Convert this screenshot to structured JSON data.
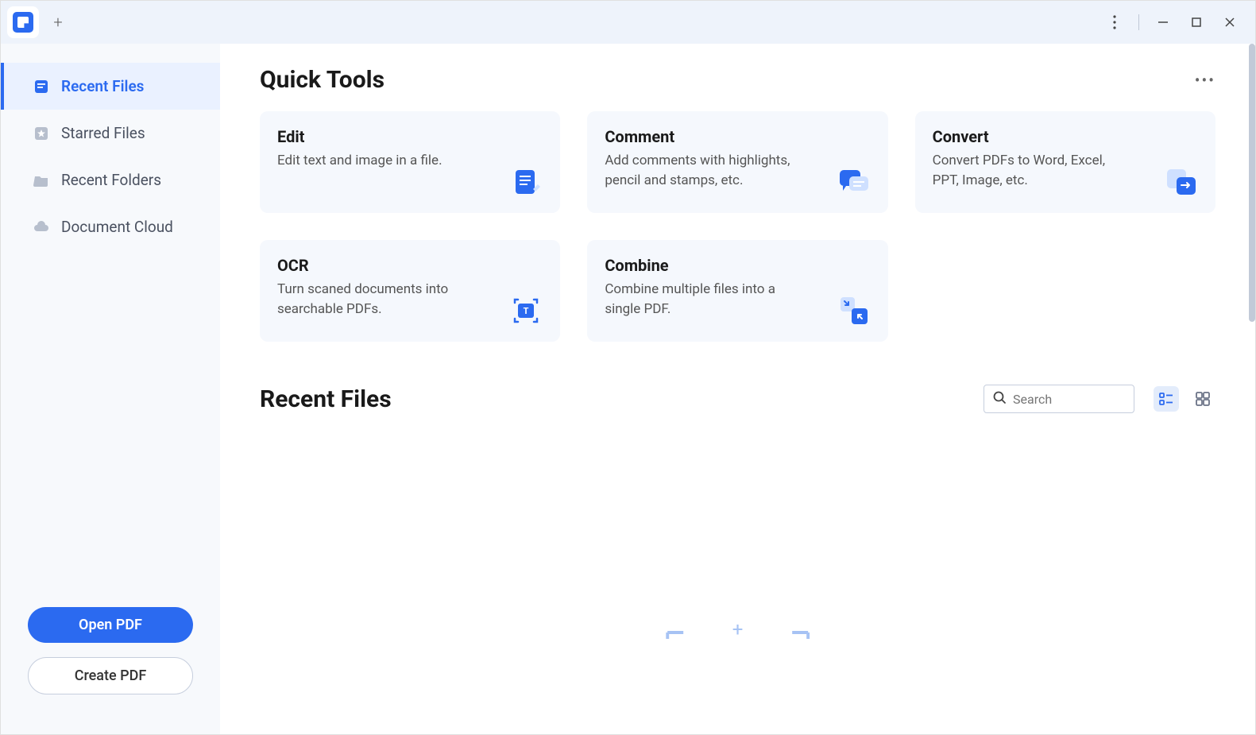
{
  "sidebar": {
    "items": [
      {
        "label": "Recent Files",
        "icon": "recent-icon"
      },
      {
        "label": "Starred Files",
        "icon": "star-icon"
      },
      {
        "label": "Recent Folders",
        "icon": "folder-icon"
      },
      {
        "label": "Document Cloud",
        "icon": "cloud-icon"
      }
    ],
    "open_pdf_label": "Open PDF",
    "create_pdf_label": "Create PDF"
  },
  "quick_tools": {
    "title": "Quick Tools",
    "cards": [
      {
        "title": "Edit",
        "desc": "Edit text and image in a file."
      },
      {
        "title": "Comment",
        "desc": "Add comments with highlights, pencil and stamps, etc."
      },
      {
        "title": "Convert",
        "desc": "Convert PDFs to Word, Excel, PPT, Image, etc."
      },
      {
        "title": "OCR",
        "desc": "Turn scaned documents into searchable PDFs."
      },
      {
        "title": "Combine",
        "desc": "Combine multiple files into a single PDF."
      }
    ]
  },
  "recent": {
    "title": "Recent Files",
    "search_placeholder": "Search"
  }
}
